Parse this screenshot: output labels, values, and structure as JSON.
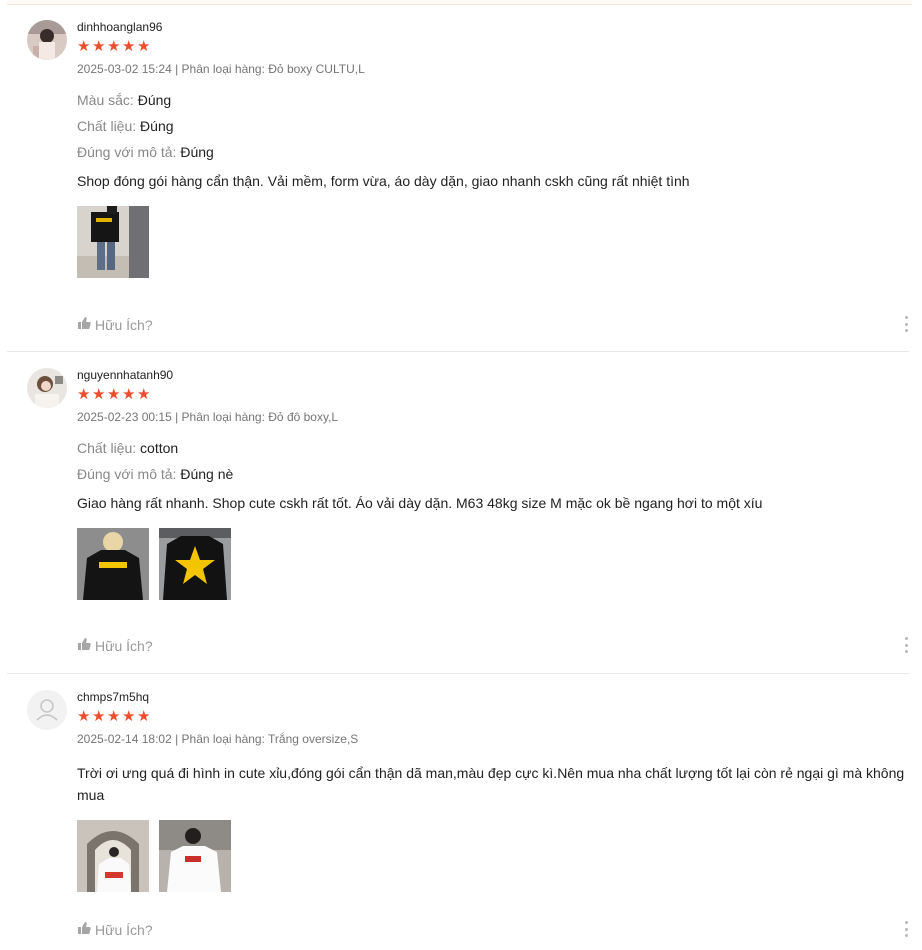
{
  "colors": {
    "star": "#ee4d2d",
    "muted": "#757575",
    "divider": "#e8e8e8"
  },
  "reviews": [
    {
      "username": "dinhhoanglan96",
      "rating": 5,
      "meta": "2025-03-02 15:24 | Phân loại hàng: Đỏ boxy CULTU,L",
      "attributes": [
        {
          "label": "Màu sắc:",
          "value": "Đúng"
        },
        {
          "label": "Chất liệu:",
          "value": "Đúng"
        },
        {
          "label": "Đúng với mô tả:",
          "value": "Đúng"
        }
      ],
      "comment": "Shop đóng gói hàng cẩn thận. Vải mềm, form vừa, áo dày dặn, giao nhanh cskh cũng rất nhiệt tình",
      "photos": [
        "mirror selfie in black t-shirt"
      ],
      "helpful_label": "Hữu Ích?"
    },
    {
      "username": "nguyennhatanh90",
      "rating": 5,
      "meta": "2025-02-23 00:15 | Phân loại hàng: Đỏ đô boxy,L",
      "attributes": [
        {
          "label": "Chất liệu:",
          "value": "cotton"
        },
        {
          "label": "Đúng với mô tả:",
          "value": "Đúng nè"
        }
      ],
      "comment": "Giao hàng rất nhanh. Shop cute cskh rất tốt. Áo vải dày dặn. M63 48kg size M mặc ok bề ngang hơi to một xíu",
      "photos": [
        "model front black tee",
        "back print black tee"
      ],
      "helpful_label": "Hữu Ích?"
    },
    {
      "username": "chmps7m5hq",
      "rating": 5,
      "meta": "2025-02-14 18:02 | Phân loại hàng: Trắng oversize,S",
      "attributes": [],
      "comment": "Trời ơi ưng quá đi  hình in cute xỉu,đóng gói cẩn thận dã man,màu đẹp cực kì.Nên mua nha chất lượng tốt lại còn rẻ ngại gì mà không mua",
      "photos": [
        "white tee in archway",
        "white tee front"
      ],
      "helpful_label": "Hữu Ích?"
    }
  ]
}
